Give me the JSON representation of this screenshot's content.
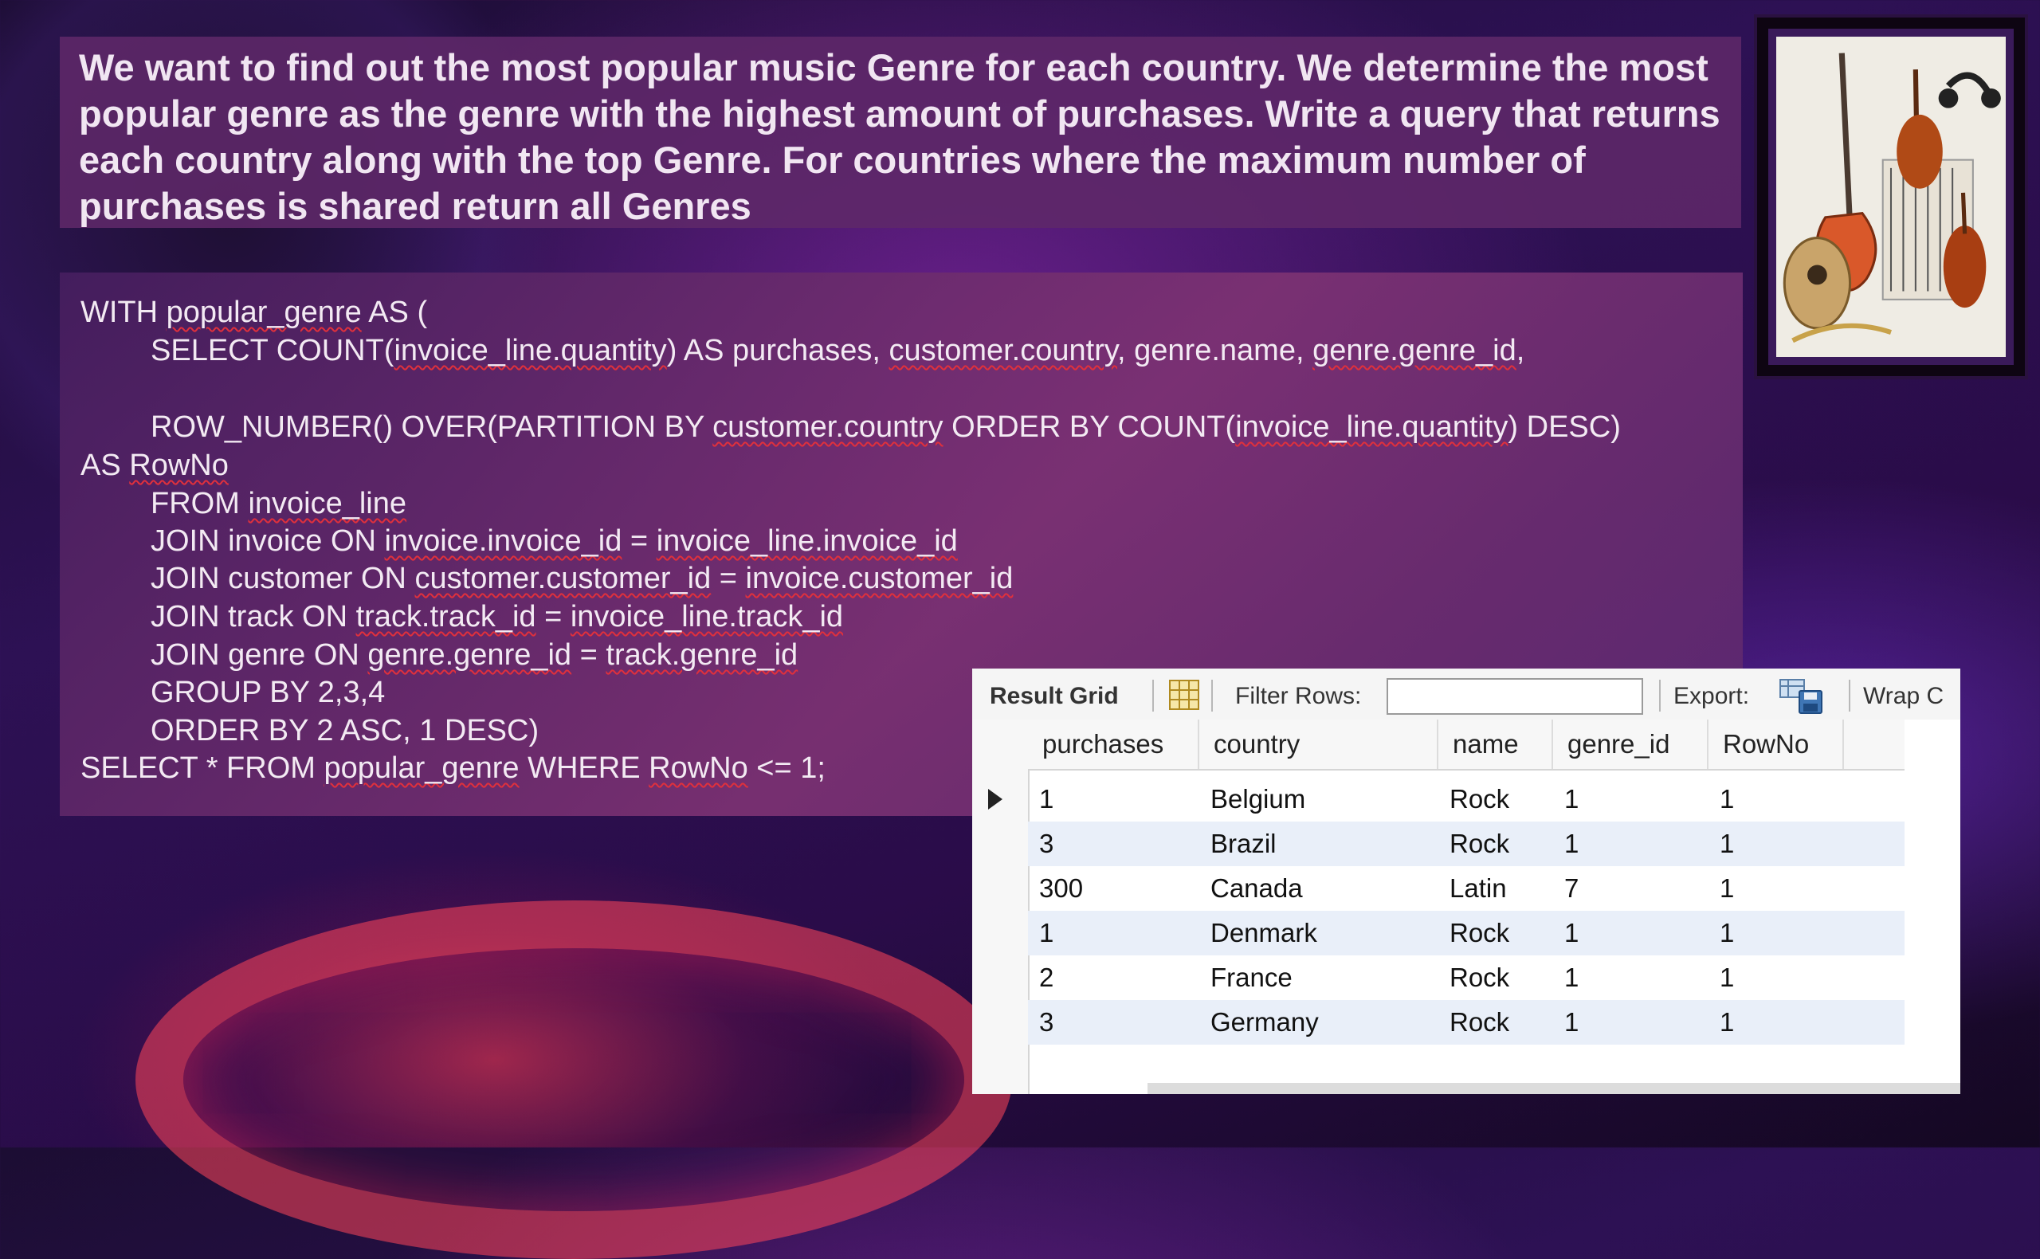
{
  "question": "We want to find out the most popular music Genre for each country. We determine the most popular genre as the genre with the highest amount of purchases. Write a query that returns each country along with the top Genre. For countries where the maximum number of purchases is shared return all Genres",
  "query": {
    "line1_a": "WITH ",
    "line1_b": "popular_genre",
    "line1_c": " AS (",
    "line2_a": "SELECT COUNT(",
    "line2_b": "invoice_line.quantity",
    "line2_c": ") AS purchases, ",
    "line2_d": "customer.country",
    "line2_e": ", genre.name, ",
    "line2_f": "genre.genre_id",
    "line2_g": ",",
    "line3_a": "ROW_NUMBER() OVER(PARTITION BY ",
    "line3_b": "customer.country",
    "line3_c": " ORDER BY COUNT(",
    "line3_d": "invoice_line.quantity",
    "line3_e": ") DESC)",
    "line4_a": "AS ",
    "line4_b": "RowNo",
    "line5_a": "FROM ",
    "line5_b": "invoice_line",
    "line6_a": "JOIN invoice ON ",
    "line6_b": "invoice.invoice_id",
    "line6_c": " = ",
    "line6_d": "invoice_line.invoice_id",
    "line7_a": "JOIN customer ON ",
    "line7_b": "customer.customer_id",
    "line7_c": " = ",
    "line7_d": "invoice.customer_id",
    "line8_a": "JOIN track ON ",
    "line8_b": "track.track_id",
    "line8_c": " = ",
    "line8_d": "invoice_line.track_id",
    "line9_a": "JOIN genre ON ",
    "line9_b": "genre.genre_id",
    "line9_c": " = ",
    "line9_d": "track.genre_id",
    "line10": "GROUP BY 2,3,4",
    "line11": "ORDER BY 2 ASC, 1 DESC)",
    "line12_a": "SELECT * FROM ",
    "line12_b": "popular_genre",
    "line12_c": " WHERE ",
    "line12_d": "RowNo",
    "line12_e": " <= 1;"
  },
  "result_panel": {
    "toolbar": {
      "result_grid_label": "Result Grid",
      "filter_label": "Filter Rows:",
      "filter_value": "",
      "export_label": "Export:",
      "wrap_label": "Wrap C"
    },
    "columns": [
      "purchases",
      "country",
      "name",
      "genre_id",
      "RowNo"
    ],
    "rows": [
      {
        "purchases": "1",
        "country": "Belgium",
        "name": "Rock",
        "genre_id": "1",
        "RowNo": "1"
      },
      {
        "purchases": "3",
        "country": "Brazil",
        "name": "Rock",
        "genre_id": "1",
        "RowNo": "1"
      },
      {
        "purchases": "300",
        "country": "Canada",
        "name": "Latin",
        "genre_id": "7",
        "RowNo": "1"
      },
      {
        "purchases": "1",
        "country": "Denmark",
        "name": "Rock",
        "genre_id": "1",
        "RowNo": "1"
      },
      {
        "purchases": "2",
        "country": "France",
        "name": "Rock",
        "genre_id": "1",
        "RowNo": "1"
      },
      {
        "purchases": "3",
        "country": "Germany",
        "name": "Rock",
        "genre_id": "1",
        "RowNo": "1"
      }
    ]
  },
  "icons": {
    "grid_icon": "result-grid-icon",
    "export_icon": "export-save-icon",
    "row_pointer": "current-row-pointer-icon",
    "instruments": "instruments-photo"
  },
  "colors": {
    "underline": "#e0303c",
    "alt_row": "#e9eff9"
  }
}
